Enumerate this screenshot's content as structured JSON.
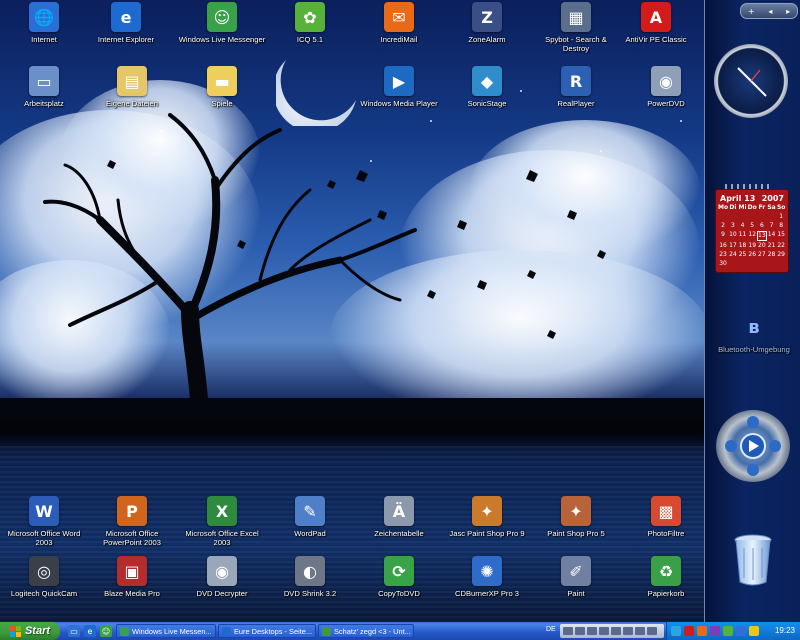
{
  "desktop": {
    "icons": [
      {
        "label": "Internet",
        "icon": "internet-icon",
        "color": "#2a6fd6",
        "glyph": "🌐"
      },
      {
        "label": "Internet Explorer",
        "icon": "ie-icon",
        "color": "#1e6ad1",
        "glyph": "e"
      },
      {
        "label": "Windows Live Messenger",
        "icon": "messenger-icon",
        "color": "#3aa14b",
        "glyph": "☺"
      },
      {
        "label": "ICQ 5.1",
        "icon": "icq-icon",
        "color": "#58b23a",
        "glyph": "✿"
      },
      {
        "label": "IncrediMail",
        "icon": "incredimail-icon",
        "color": "#e86a19",
        "glyph": "✉"
      },
      {
        "label": "ZoneAlarm",
        "icon": "zonealarm-icon",
        "color": "#3a4f86",
        "glyph": "Z"
      },
      {
        "label": "Spybot - Search & Destroy",
        "icon": "spybot-icon",
        "color": "#5b6f8c",
        "glyph": "▦"
      },
      {
        "label": "AntiVir PE Classic",
        "icon": "antivir-icon",
        "color": "#d21c1c",
        "glyph": "A"
      },
      {
        "label": "Arbeitsplatz",
        "icon": "my-computer-icon",
        "color": "#6b8fc8",
        "glyph": "▭"
      },
      {
        "label": "Eigene Dateien",
        "icon": "my-documents-icon",
        "color": "#e6c768",
        "glyph": "▤"
      },
      {
        "label": "Spiele",
        "icon": "folder-icon",
        "color": "#efcf5b",
        "glyph": "▬"
      },
      {
        "label": "Windows Media Player",
        "icon": "wmp-icon",
        "color": "#1d6ac2",
        "glyph": "▶"
      },
      {
        "label": "SonicStage",
        "icon": "sonicstage-icon",
        "color": "#2f8dcc",
        "glyph": "◆"
      },
      {
        "label": "RealPlayer",
        "icon": "realplayer-icon",
        "color": "#2d5fb2",
        "glyph": "R"
      },
      {
        "label": "PowerDVD",
        "icon": "powerdvd-icon",
        "color": "#8f9fb8",
        "glyph": "◉"
      },
      {
        "label": "Microsoft Office Word 2003",
        "icon": "word-icon",
        "color": "#2b5cb8",
        "glyph": "W"
      },
      {
        "label": "Microsoft Office PowerPoint 2003",
        "icon": "powerpoint-icon",
        "color": "#d2651e",
        "glyph": "P"
      },
      {
        "label": "Microsoft Office Excel 2003",
        "icon": "excel-icon",
        "color": "#2d8a3e",
        "glyph": "X"
      },
      {
        "label": "WordPad",
        "icon": "wordpad-icon",
        "color": "#4f7fc9",
        "glyph": "✎"
      },
      {
        "label": "Zeichentabelle",
        "icon": "charmap-icon",
        "color": "#8c99ad",
        "glyph": "Ä"
      },
      {
        "label": "Jasc Paint Shop Pro 9",
        "icon": "psp9-icon",
        "color": "#c97a2b",
        "glyph": "✦"
      },
      {
        "label": "Paint Shop Pro 5",
        "icon": "psp5-icon",
        "color": "#b8633a",
        "glyph": "✦"
      },
      {
        "label": "PhotoFiltre",
        "icon": "photofiltre-icon",
        "color": "#d84a2f",
        "glyph": "▩"
      },
      {
        "label": "Logitech QuickCam",
        "icon": "quickcam-icon",
        "color": "#3a3f4a",
        "glyph": "◎"
      },
      {
        "label": "Blaze Media Pro",
        "icon": "blaze-icon",
        "color": "#b52c2c",
        "glyph": "▣"
      },
      {
        "label": "DVD Decrypter",
        "icon": "dvd-decrypter-icon",
        "color": "#9aa6b9",
        "glyph": "◉"
      },
      {
        "label": "DVD Shrink 3.2",
        "icon": "dvd-shrink-icon",
        "color": "#6e7787",
        "glyph": "◐"
      },
      {
        "label": "CopyToDVD",
        "icon": "copytodvd-icon",
        "color": "#39a348",
        "glyph": "⟳"
      },
      {
        "label": "CDBurnerXP Pro 3",
        "icon": "cdburner-icon",
        "color": "#2f6cc9",
        "glyph": "✺"
      },
      {
        "label": "Paint",
        "icon": "paint-icon",
        "color": "#6f80a3",
        "glyph": "✐"
      },
      {
        "label": "Papierkorb",
        "icon": "recycle-bin-icon",
        "color": "#3aa048",
        "glyph": "♻"
      }
    ]
  },
  "sidebar": {
    "top_controls": [
      "+",
      "◂",
      "▸"
    ],
    "calendar": {
      "month": "April 13",
      "year": "2007",
      "weekdays": [
        "Mo",
        "Di",
        "Mi",
        "Do",
        "Fr",
        "Sa",
        "So"
      ],
      "days": [
        "",
        "",
        "",
        "",
        "",
        "",
        "1",
        "2",
        "3",
        "4",
        "5",
        "6",
        "7",
        "8",
        "9",
        "10",
        "11",
        "12",
        "13",
        "14",
        "15",
        "16",
        "17",
        "18",
        "19",
        "20",
        "21",
        "22",
        "23",
        "24",
        "25",
        "26",
        "27",
        "28",
        "29",
        "30",
        "",
        "",
        "",
        "",
        "",
        ""
      ],
      "today": "13"
    },
    "bluetooth_label": "Bluetooth-Umgebung",
    "media_controls": [
      "⏮",
      "▶",
      "⏭",
      "⏹",
      "⏸"
    ]
  },
  "taskbar": {
    "start_label": "Start",
    "tasks": [
      {
        "label": "Windows Live Messen...",
        "color": "#3aa14b"
      },
      {
        "label": "Eure Desktops - Seite...",
        "color": "#1e6ad1"
      },
      {
        "label": "Schatz' zegd <3 - Unt...",
        "color": "#3f9b3a"
      }
    ],
    "language": "DE",
    "time": "19:23"
  }
}
